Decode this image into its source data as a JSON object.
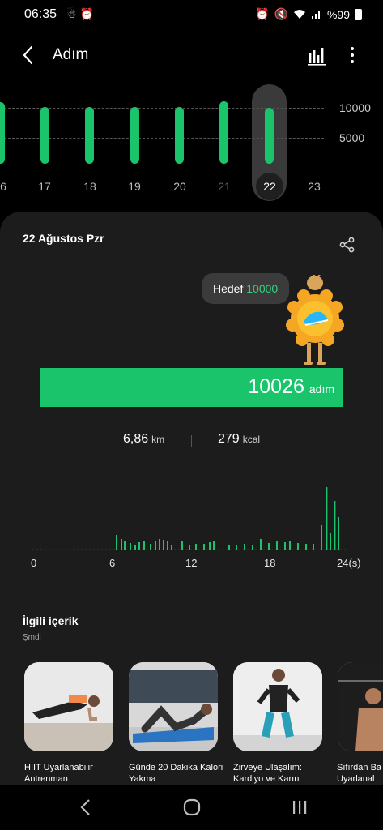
{
  "status_bar": {
    "time": "06:35",
    "battery": "%99",
    "left_icons": [
      "notification-icon",
      "alarm-icon"
    ],
    "right_icons": [
      "alarm-icon",
      "mute-icon",
      "wifi-icon",
      "signal-icon",
      "battery-icon"
    ]
  },
  "app_bar": {
    "title": "Adım",
    "back_icon": "chevron-left-icon",
    "chart_icon": "bar-chart-icon",
    "more_icon": "more-vertical-icon"
  },
  "history": {
    "axis_labels": [
      "10000",
      "5000"
    ],
    "days": [
      "6",
      "17",
      "18",
      "19",
      "20",
      "21",
      "22",
      "23"
    ],
    "selected_day": "22",
    "accent_color": "#19c46a"
  },
  "day_card": {
    "date": "22 Ağustos Pzr",
    "share_icon": "share-icon",
    "goal_label": "Hedef",
    "goal_value": "10000",
    "steps": "10026",
    "steps_unit": "adım",
    "progress_fraction": 1.0,
    "distance": "6,86",
    "distance_unit": "km",
    "calories": "279",
    "calories_unit": "kcal"
  },
  "hourly_chart": {
    "ticks": [
      "0",
      "6",
      "12",
      "18",
      "24(s)"
    ]
  },
  "related": {
    "title": "İlgili içerik",
    "subtitle": "Şmdi",
    "items": [
      {
        "caption": "HIIT Uyarlanabilir Antrenman"
      },
      {
        "caption": "Günde 20 Dakika Kalori Yakma"
      },
      {
        "caption": "Zirveye Ulaşalım: Kardiyo ve Karın"
      },
      {
        "caption": "Sıfırdan Ba Uyarlanal"
      }
    ]
  },
  "nav_bar": {
    "back_icon": "back-icon",
    "home_icon": "home-icon",
    "recents_icon": "recents-icon"
  }
}
